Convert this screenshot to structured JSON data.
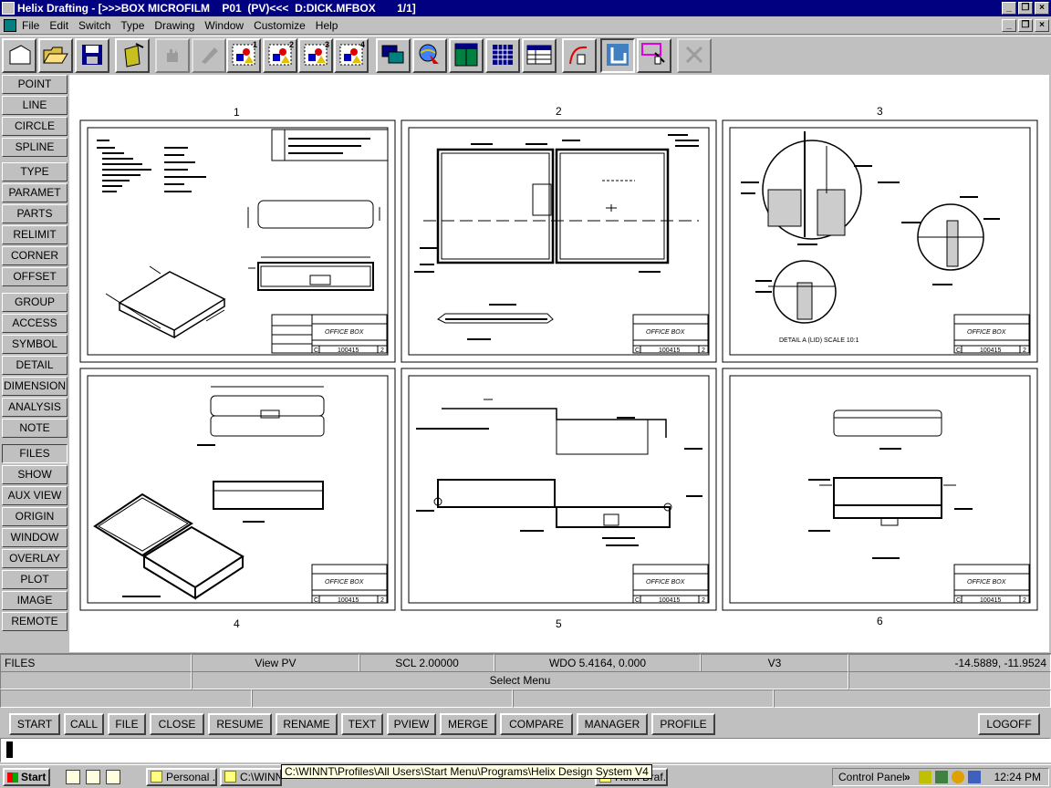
{
  "window": {
    "title": "Helix Drafting - [>>>BOX MICROFILM    P01  (PV)<<<  D:DICK.MFBOX       1/1]",
    "menu": [
      "File",
      "Edit",
      "Switch",
      "Type",
      "Drawing",
      "Window",
      "Customize",
      "Help"
    ],
    "min": "_",
    "restore": "❐",
    "close": "×"
  },
  "toolbar": {
    "icons": [
      "new-sheet-icon",
      "open-folder-icon",
      "save-disk-icon",
      "notebook-icon",
      "hand-icon",
      "pencil-icon",
      "view-1-icon",
      "view-2-icon",
      "view-3-icon",
      "view-4-icon",
      "windows-icon",
      "globe-pointer-icon",
      "layout-icon",
      "grid-icon",
      "table-icon",
      "curve-icon",
      "return-arrow-icon",
      "select-box-icon",
      "disabled-icon"
    ],
    "view_numbers": [
      "1",
      "2",
      "3",
      "4"
    ]
  },
  "sidebar": [
    "POINT",
    "LINE",
    "CIRCLE",
    "SPLINE",
    "TYPE",
    "PARAMET",
    "PARTS",
    "RELIMIT",
    "CORNER",
    "OFFSET",
    "GROUP",
    "ACCESS",
    "SYMBOL",
    "DETAIL",
    "DIMENSION",
    "ANALYSIS",
    "NOTE",
    "FILES",
    "SHOW",
    "AUX VIEW",
    "ORIGIN",
    "WINDOW",
    "OVERLAY",
    "PLOT",
    "IMAGE",
    "REMOTE"
  ],
  "sheets": {
    "labels": [
      "1",
      "2",
      "3",
      "4",
      "5",
      "6"
    ],
    "title_block": "OFFICE BOX",
    "part_no": "100415",
    "sheet_no": "2",
    "zone_letter": "C",
    "detail_note": "DETAIL A (LID) SCALE 10:1"
  },
  "status": {
    "mode": "FILES",
    "view": "View PV",
    "scale": "SCL 2.00000",
    "window": "WDO 5.4164, 0.000",
    "version": "V3",
    "coords": "-14.5889, -11.9524",
    "prompt": "Select Menu"
  },
  "commands": [
    "START",
    "CALL",
    "FILE",
    "CLOSE",
    "RESUME",
    "RENAME",
    "TEXT",
    "PVIEW",
    "MERGE",
    "COMPARE",
    "MANAGER",
    "PROFILE"
  ],
  "logoff": "LOGOFF",
  "taskbar": {
    "start": "Start",
    "tasks": [
      "Personal ...",
      "C:\\WINNT",
      "Helix Draf..."
    ],
    "tooltip": "C:\\WINNT\\Profiles\\All Users\\Start Menu\\Programs\\Helix Design System V4",
    "tray_label": "Control Panel",
    "chevron": "»",
    "time": "12:24 PM"
  }
}
